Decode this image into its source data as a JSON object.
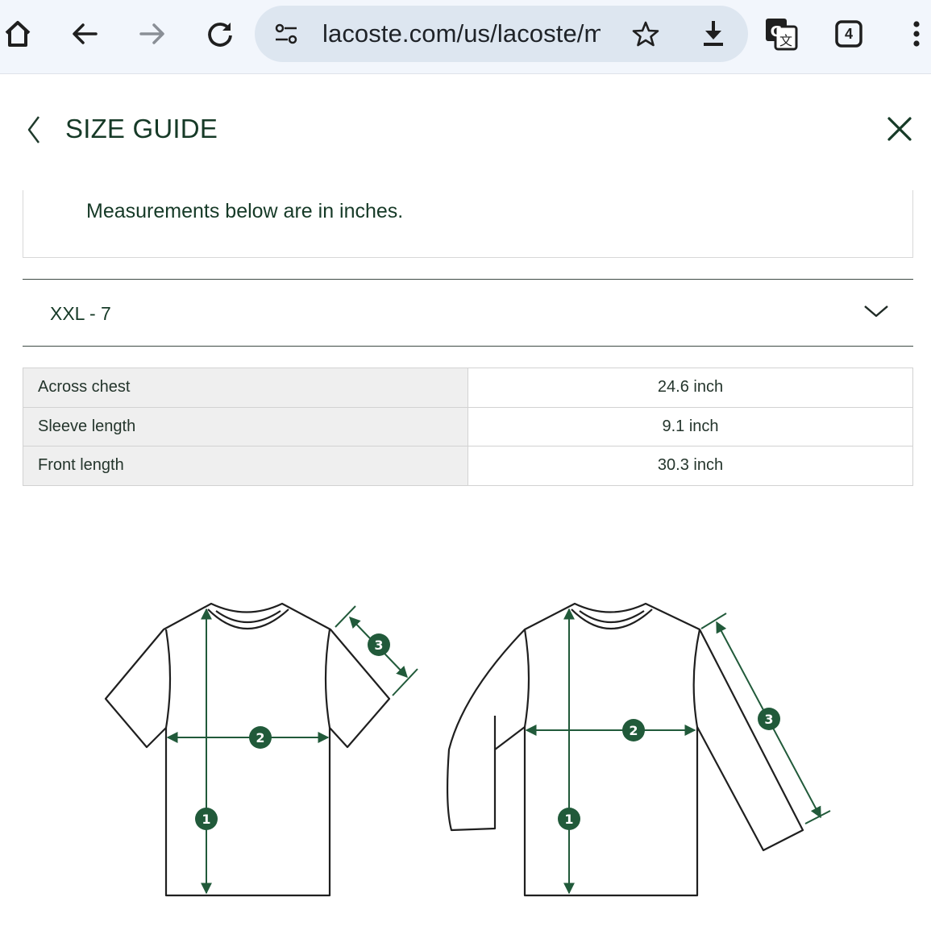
{
  "browser": {
    "url": "lacoste.com/us/lacoste/m",
    "tab_count": "4",
    "icons": [
      "home-icon",
      "back-arrow-icon",
      "forward-arrow-icon",
      "reload-icon",
      "site-settings-icon",
      "bookmark-star-icon",
      "download-icon",
      "translate-icon",
      "tab-switcher-icon",
      "more-menu-icon"
    ]
  },
  "size_guide": {
    "title": "SIZE GUIDE",
    "note": "Measurements below are in inches.",
    "selected_size": "XXL - 7",
    "rows": [
      {
        "label": "Across chest",
        "value": "24.6 inch"
      },
      {
        "label": "Sleeve length",
        "value": "9.1 inch"
      },
      {
        "label": "Front length",
        "value": "30.3 inch"
      }
    ]
  },
  "diagram": {
    "markers": [
      "1",
      "2",
      "3"
    ],
    "accent_color": "#215a3a",
    "outline_color": "#1f1f1f"
  }
}
